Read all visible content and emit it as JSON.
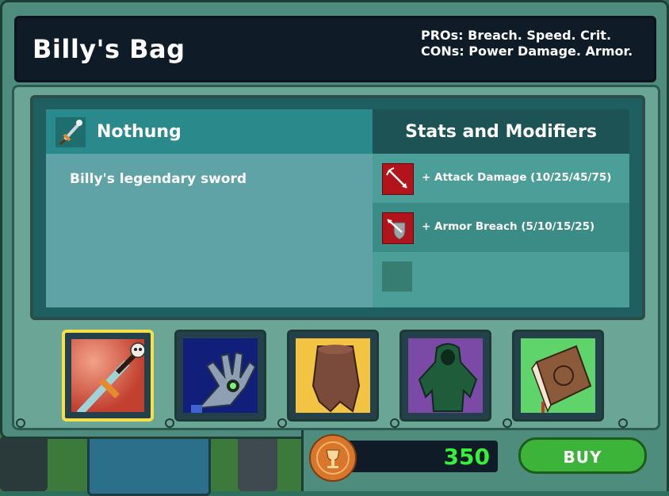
{
  "header": {
    "title": "Billy's Bag",
    "pros_cons": "PROs: Breach. Speed. Crit.   CONs: Power Damage.  Armor."
  },
  "item": {
    "name": "Nothung",
    "description": "Billy's legendary sword",
    "icon": "sword-icon"
  },
  "stats": {
    "title": "Stats and Modifiers",
    "modifiers": [
      {
        "label": "+ Attack Damage (10/25/45/75)",
        "icon": "arrow-burst-icon"
      },
      {
        "label": "+ Armor Breach (5/10/15/25)",
        "icon": "pierced-shield-icon"
      }
    ]
  },
  "slots": [
    {
      "name": "sword-slot",
      "icon": "sword-icon",
      "selected": true
    },
    {
      "name": "gauntlet-slot",
      "icon": "gauntlet-icon",
      "selected": false
    },
    {
      "name": "cape-slot",
      "icon": "cape-icon",
      "selected": false
    },
    {
      "name": "cloak-slot",
      "icon": "hooded-cloak-icon",
      "selected": false
    },
    {
      "name": "book-slot",
      "icon": "spellbook-icon",
      "selected": false
    }
  ],
  "shop": {
    "price": "350",
    "buy_label": "BUY",
    "currency_icon": "gold-coin-icon"
  },
  "colors": {
    "price": "#34f23a",
    "buy_button": "#3cb43a",
    "selected_slot_border": "#f5e04a"
  }
}
